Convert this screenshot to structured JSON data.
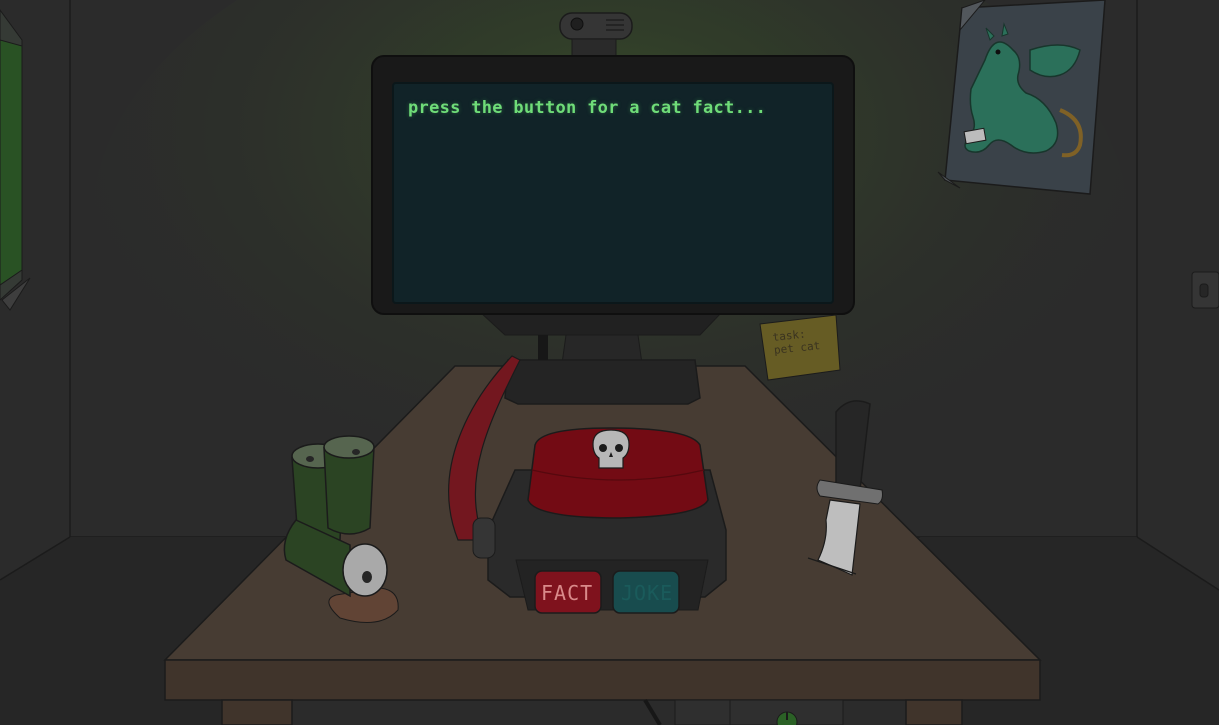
{
  "monitor": {
    "screen_text": "press the button for a cat fact..."
  },
  "sticky_note": {
    "text": "task:\npet cat"
  },
  "button_box": {
    "fact_label": "FACT",
    "joke_label": "JOKE"
  },
  "colors": {
    "wall": "#2f2f2f",
    "screen_bg": "#13272c",
    "screen_text": "#6fdc78",
    "desk": "#4e4238",
    "red_button": "#7d0d16",
    "fact_button": "#8a1420",
    "joke_button": "#1b5355",
    "sticky_note": "#6f6428",
    "cans": "#2f4a26",
    "dragon": "#2f7a62"
  },
  "icons": {
    "red_button_emblem": "skull-icon",
    "power_icon": "power-icon",
    "webcam": "webcam-icon",
    "wall_outlet": "outlet-icon"
  }
}
